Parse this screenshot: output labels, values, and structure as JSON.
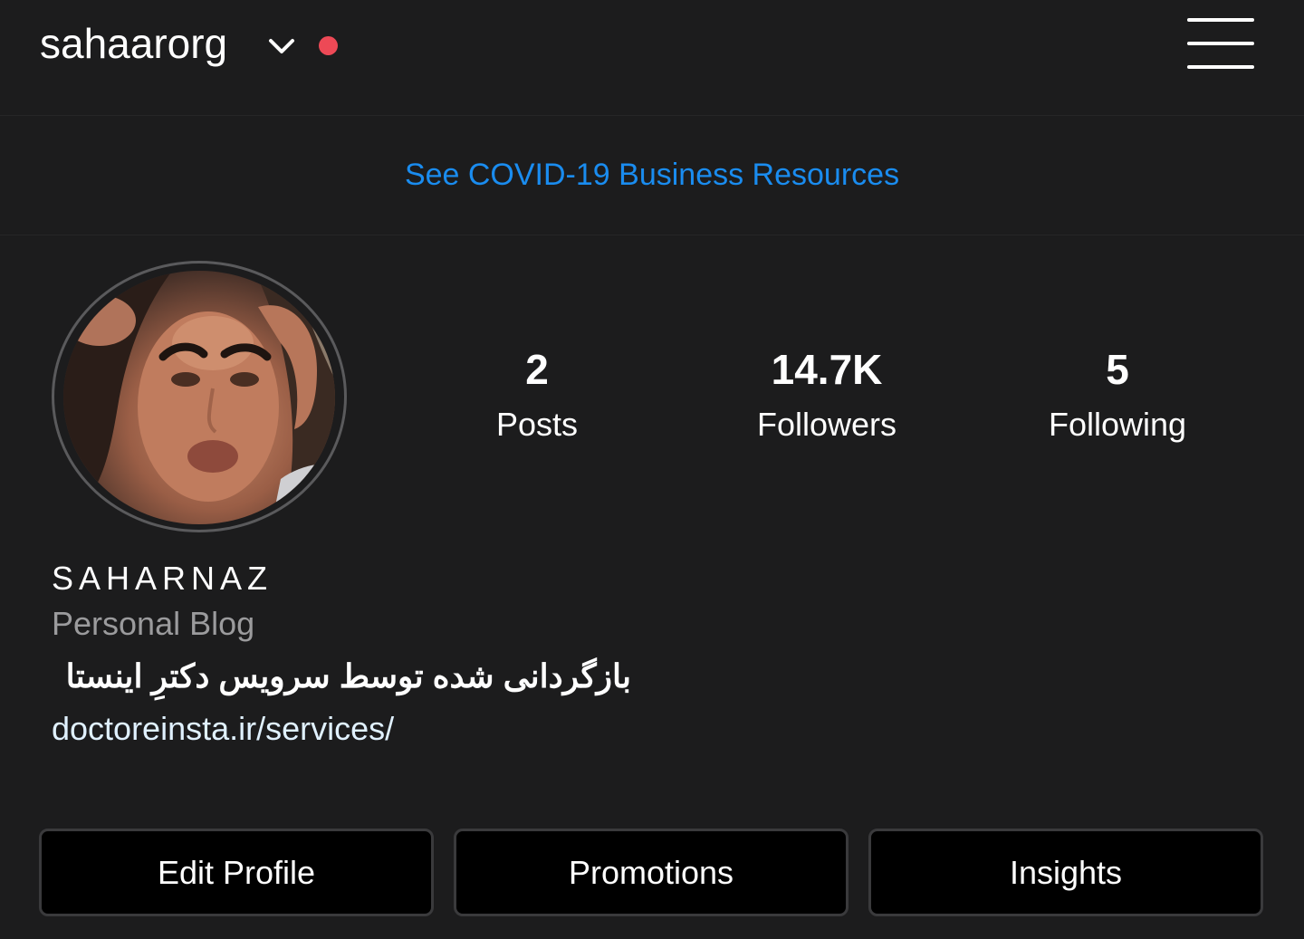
{
  "header": {
    "username": "sahaarorg",
    "notification_color": "#ed4956"
  },
  "banner": {
    "link_text": "See COVID-19 Business Resources",
    "link_color": "#1a8cef"
  },
  "stats": [
    {
      "value": "2",
      "label": "Posts"
    },
    {
      "value": "14.7K",
      "label": "Followers"
    },
    {
      "value": "5",
      "label": "Following"
    }
  ],
  "profile": {
    "display_name": "SAHARNAZ",
    "category": "Personal Blog",
    "bio": "بازگردانی شده توسط سرویس دکترِ اینستا",
    "website": "doctoreinsta.ir/services/"
  },
  "actions": {
    "edit_profile": "Edit Profile",
    "promotions": "Promotions",
    "insights": "Insights"
  },
  "icons": {
    "dropdown": "chevron-down-icon",
    "menu": "hamburger-menu-icon"
  },
  "colors": {
    "background": "#1c1c1d",
    "button_background": "#000000",
    "category_text": "#9b9b9d"
  }
}
